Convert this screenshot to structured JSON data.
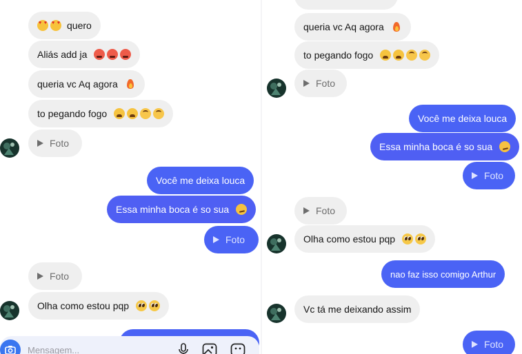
{
  "colors": {
    "incoming_bubble": "#efefef",
    "outgoing_bubble": "#4a63f5",
    "background": "#ffffff"
  },
  "left": {
    "messages": {
      "m1": {
        "text": "quero",
        "emojis": [
          "smiling-face-with-heart-eyes",
          "smiling-face-with-heart-eyes"
        ]
      },
      "m2": {
        "text": "Aliás add ja",
        "emojis": [
          "hot-face",
          "hot-face",
          "hot-face"
        ]
      },
      "m3": {
        "text": "queria vc Aq agora",
        "emojis": [
          "fire"
        ]
      },
      "m4": {
        "text": "to pegando fogo",
        "emojis": [
          "tired-face",
          "tired-face",
          "upside-down-face",
          "upside-down-face"
        ]
      },
      "m5": {
        "text": "Foto",
        "icon": "play-icon"
      },
      "m6": {
        "text": "Você me deixa louca"
      },
      "m7": {
        "text": "Essa minha boca é so sua",
        "emojis": [
          "smirking-face"
        ]
      },
      "m8": {
        "text": "Foto",
        "icon": "play-icon"
      },
      "m9": {
        "text": "Foto",
        "icon": "play-icon"
      },
      "m10": {
        "text": "Olha como estou pqp",
        "emojis": [
          "pleading-face",
          "pleading-face"
        ]
      }
    },
    "composer": {
      "placeholder": "Mensagem...",
      "icons": [
        "camera-icon",
        "microphone-icon",
        "gallery-icon",
        "sticker-icon"
      ]
    }
  },
  "right": {
    "messages": {
      "m1": {
        "text": "queria vc Aq agora",
        "emojis": [
          "fire"
        ]
      },
      "m2": {
        "text": "to pegando fogo",
        "emojis": [
          "tired-face",
          "tired-face",
          "upside-down-face",
          "upside-down-face"
        ]
      },
      "m3": {
        "text": "Foto",
        "icon": "play-icon"
      },
      "m4": {
        "text": "Você me deixa louca"
      },
      "m5": {
        "text": "Essa minha boca é so sua",
        "emojis": [
          "smirking-face"
        ]
      },
      "m6": {
        "text": "Foto",
        "icon": "play-icon"
      },
      "m7": {
        "text": "Foto",
        "icon": "play-icon"
      },
      "m8": {
        "text": "Olha como estou pqp",
        "emojis": [
          "pleading-face",
          "pleading-face"
        ]
      },
      "m9": {
        "text": "nao faz isso comigo Arthur"
      },
      "m10": {
        "text": "Vc tá me deixando assim"
      },
      "m11": {
        "text": "Foto",
        "icon": "play-icon"
      }
    }
  }
}
